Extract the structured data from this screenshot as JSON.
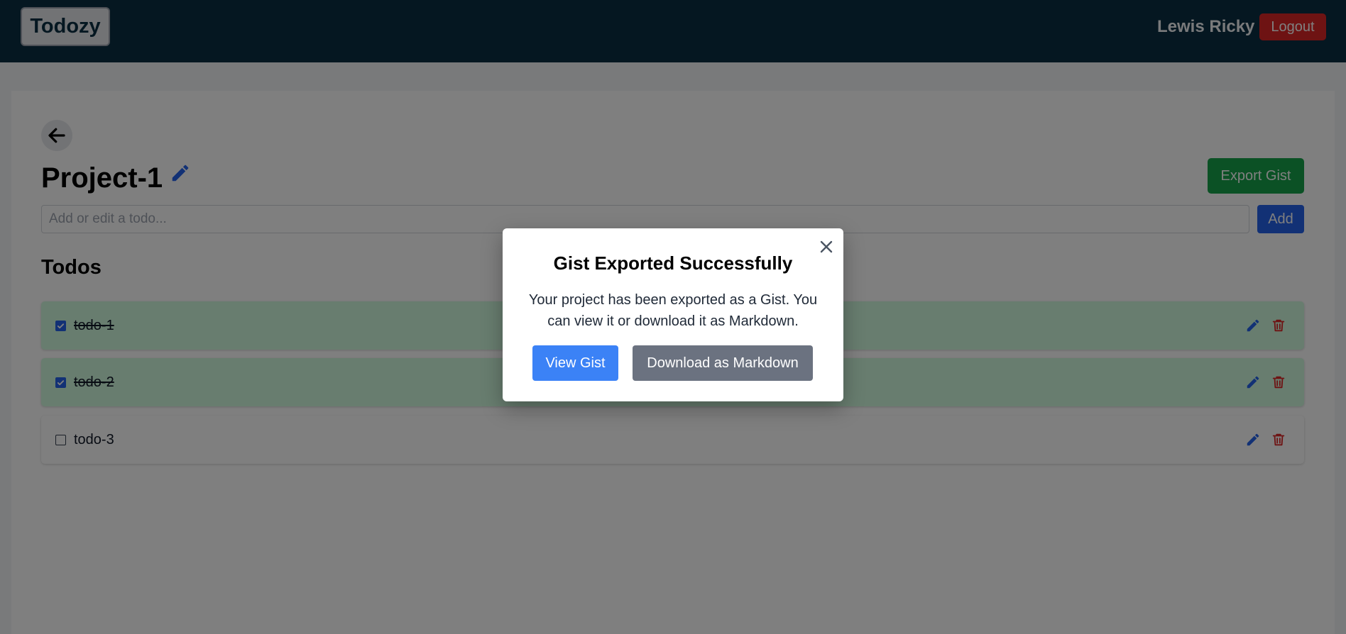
{
  "navbar": {
    "logo": "Todozy",
    "username": "Lewis Ricky",
    "logout_label": "Logout"
  },
  "project": {
    "title": "Project-1",
    "export_label": "Export Gist",
    "input_placeholder": "Add or edit a todo...",
    "add_label": "Add"
  },
  "todos": {
    "heading": "Todos",
    "items": [
      {
        "text": "todo-1",
        "completed": true
      },
      {
        "text": "todo-2",
        "completed": true
      },
      {
        "text": "todo-3",
        "completed": false
      }
    ]
  },
  "modal": {
    "title": "Gist Exported Successfully",
    "message": "Your project has been exported as a Gist. You can view it or download it as Markdown.",
    "view_label": "View Gist",
    "download_label": "Download as Markdown"
  },
  "colors": {
    "navbar": "#0a2e42",
    "logout": "#dc2626",
    "export": "#16a34a",
    "add": "#2563eb",
    "view_gist": "#3b82f6",
    "download": "#6b7280",
    "completed_row": "#d1fadf",
    "edit_icon": "#2563eb",
    "delete_icon": "#dc2626"
  },
  "icons": {
    "back": "arrow-left-icon",
    "edit": "pencil-icon",
    "delete": "trash-icon",
    "close": "close-icon",
    "check": "checkmark-icon"
  }
}
